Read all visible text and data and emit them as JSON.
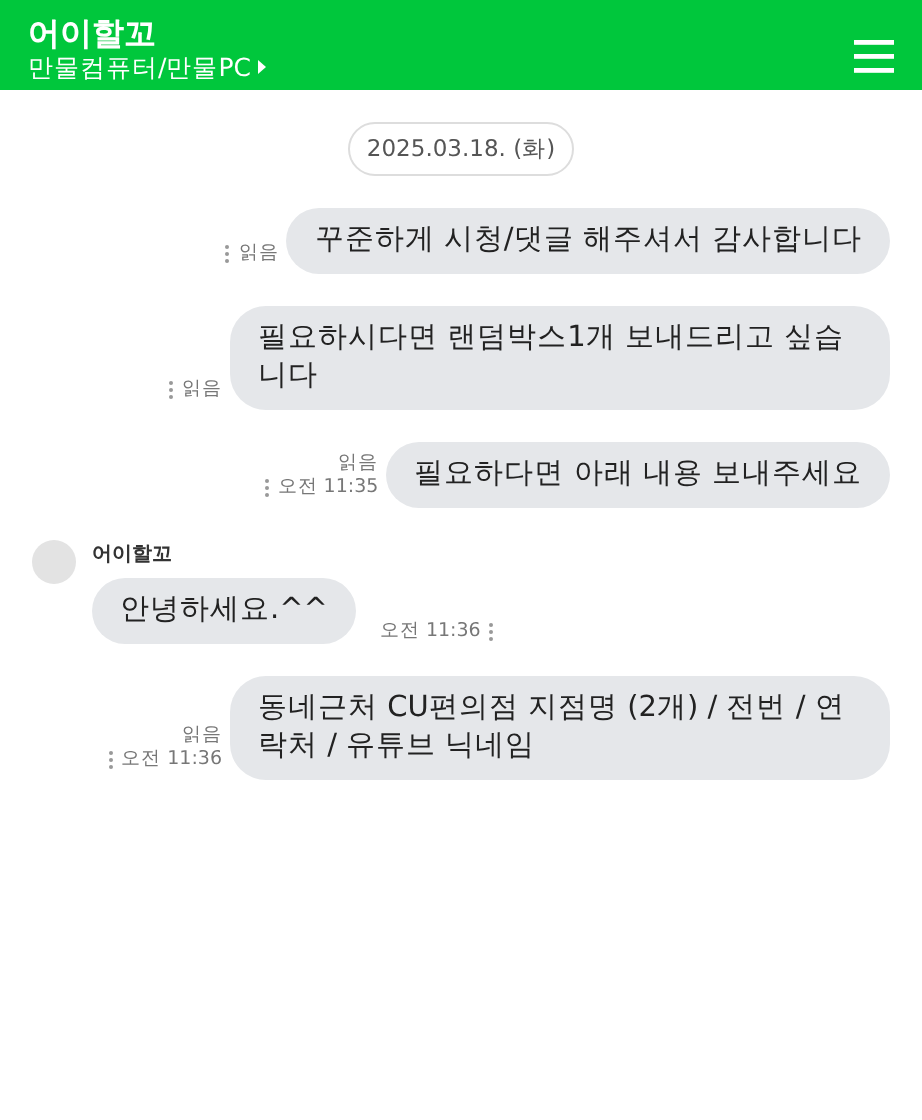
{
  "header": {
    "title": "어이할꼬",
    "subtitle": "만물컴퓨터/만물PC"
  },
  "date": "2025.03.18. (화)",
  "messages": [
    {
      "kind": "sent",
      "text": "꾸준하게 시청/댓글 해주셔서 감사합니다",
      "read": "읽음"
    },
    {
      "kind": "sent",
      "text": "필요하시다면 랜덤박스1개 보내드리고 싶습니다",
      "read": "읽음"
    },
    {
      "kind": "sent",
      "text": "필요하다면 아래 내용 보내주세요",
      "read": "읽음",
      "time": "오전 11:35"
    },
    {
      "kind": "received",
      "name": "어이할꼬",
      "text": "안녕하세요.^^",
      "time": "오전 11:36"
    },
    {
      "kind": "sent",
      "text": "동네근처 CU편의점 지점명 (2개) / 전번 / 연락처 / 유튜브 닉네임",
      "read": "읽음",
      "time": "오전 11:36"
    }
  ]
}
